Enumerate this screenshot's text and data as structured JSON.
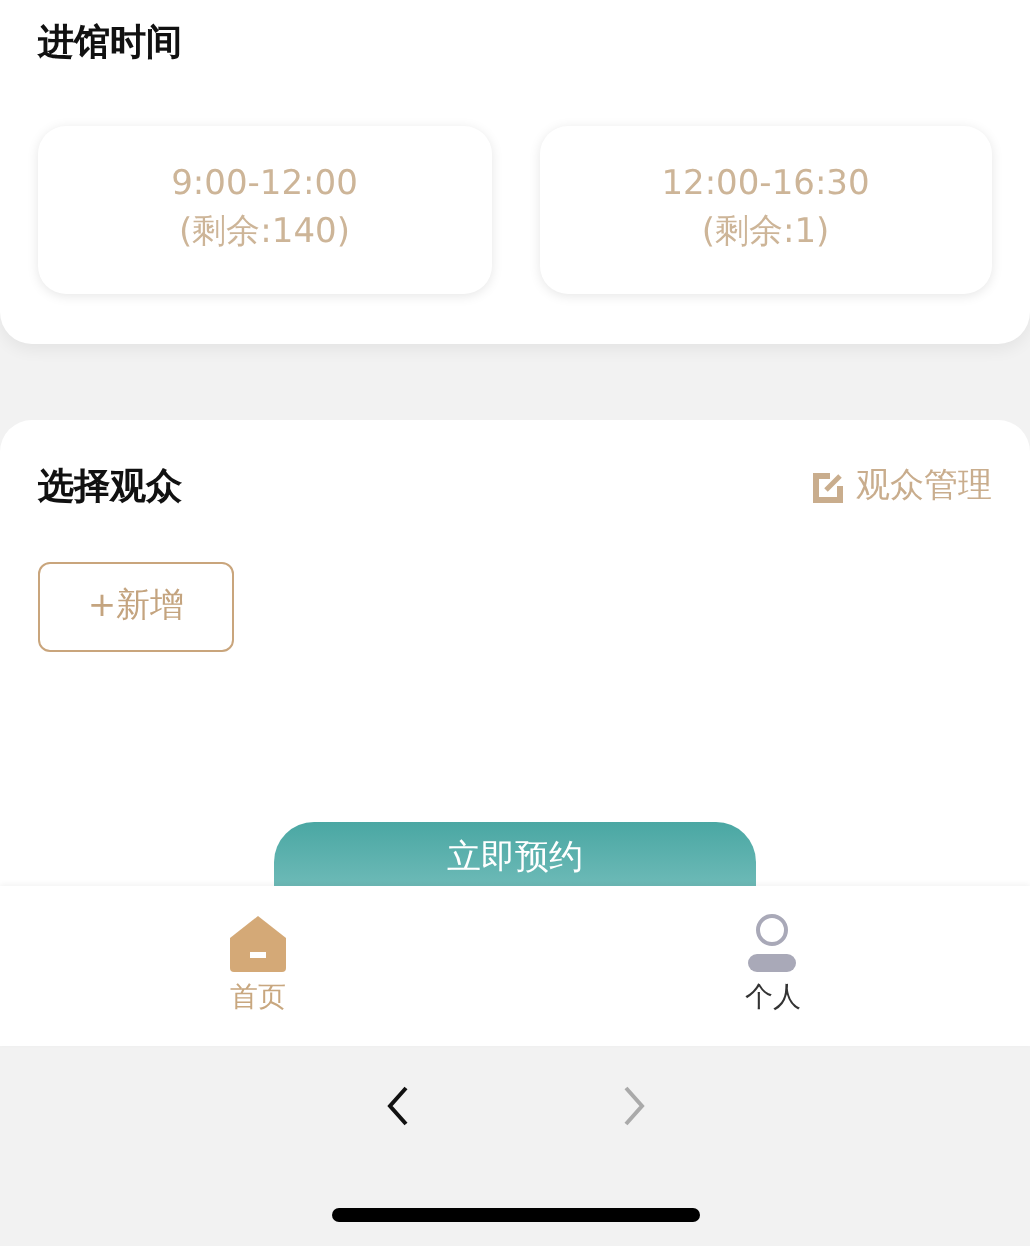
{
  "entry_time": {
    "title": "进馆时间",
    "slots": [
      {
        "time": "9:00-12:00",
        "remaining": "(剩余:140)",
        "selected": false
      },
      {
        "time": "12:00-16:30",
        "remaining": "(剩余:1)",
        "selected": false
      }
    ]
  },
  "audience": {
    "title": "选择观众",
    "manage_link": "观众管理",
    "add_button": "+新增"
  },
  "submit_button": "立即预约",
  "tab_bar": [
    {
      "label": "首页",
      "kind": "home",
      "selected": true
    },
    {
      "label": "个人",
      "kind": "person",
      "selected": false
    }
  ],
  "browser_nav": [
    {
      "kind": "back",
      "disabled": false
    },
    {
      "kind": "forward",
      "disabled": true
    }
  ]
}
